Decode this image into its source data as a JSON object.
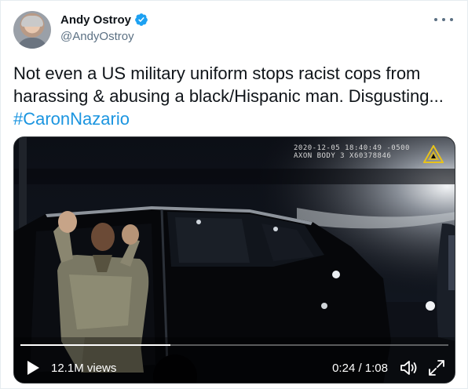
{
  "author": {
    "display_name": "Andy Ostroy",
    "handle": "@AndyOstroy",
    "verified": true
  },
  "tweet": {
    "text_line1": "Not even a US military uniform stops racist cops from",
    "text_line2": "harassing & abusing a black/Hispanic man. Disgusting...",
    "hashtag": "#CaronNazario"
  },
  "video": {
    "bodycam_line1": "2020-12-05 18:40:49 -0500",
    "bodycam_line2": "AXON BODY 3 X60378846",
    "views": "12.1M views",
    "time": "0:24 / 1:08",
    "progress_fraction": 0.35
  },
  "icons": {
    "verified": "verified-badge-icon",
    "more": "more-options-icon",
    "play": "play-icon",
    "volume": "volume-icon",
    "fullscreen": "fullscreen-icon"
  },
  "colors": {
    "link": "#1b95e0",
    "verified": "#1da1f2",
    "secondary_text": "#5b7083"
  }
}
